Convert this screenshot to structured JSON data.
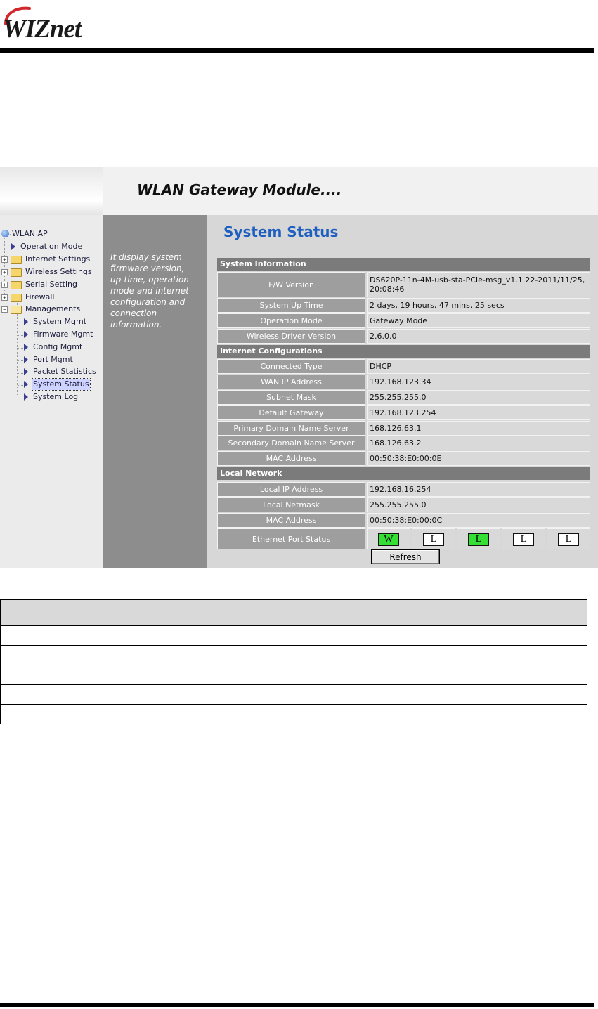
{
  "header": {
    "logo_text": "WIZnet"
  },
  "gateway": {
    "banner_title": "WLAN Gateway Module....",
    "tree": {
      "root": "WLAN AP",
      "items": [
        "Operation Mode",
        "Internet Settings",
        "Wireless Settings",
        "Serial Setting",
        "Firewall",
        "Managements",
        "System Mgmt",
        "Firmware Mgmt",
        "Config Mgmt",
        "Port Mgmt",
        "Packet Statistics",
        "System Status",
        "System Log"
      ],
      "selected": "System Status"
    },
    "description": "It display system firmware version, up-time, operation mode and internet configuration and connection information.",
    "page_title": "System Status",
    "sections": [
      {
        "title": "System Information",
        "rows": [
          {
            "label": "F/W Version",
            "value": "DS620P-11n-4M-usb-sta-PCIe-msg_v1.1.22-2011/11/25, 20:08:46"
          },
          {
            "label": "System Up Time",
            "value": "2 days, 19 hours, 47 mins, 25 secs"
          },
          {
            "label": "Operation Mode",
            "value": "Gateway Mode"
          },
          {
            "label": "Wireless Driver Version",
            "value": "2.6.0.0"
          }
        ]
      },
      {
        "title": "Internet Configurations",
        "rows": [
          {
            "label": "Connected Type",
            "value": "DHCP"
          },
          {
            "label": "WAN IP Address",
            "value": "192.168.123.34"
          },
          {
            "label": "Subnet Mask",
            "value": "255.255.255.0"
          },
          {
            "label": "Default Gateway",
            "value": "192.168.123.254"
          },
          {
            "label": "Primary Domain Name Server",
            "value": "168.126.63.1"
          },
          {
            "label": "Secondary Domain Name Server",
            "value": "168.126.63.2"
          },
          {
            "label": "MAC Address",
            "value": "00:50:38:E0:00:0E"
          }
        ]
      },
      {
        "title": "Local Network",
        "rows": [
          {
            "label": "Local IP Address",
            "value": "192.168.16.254"
          },
          {
            "label": "Local Netmask",
            "value": "255.255.255.0"
          },
          {
            "label": "MAC Address",
            "value": "00:50:38:E0:00:0C"
          }
        ]
      }
    ],
    "ethernet": {
      "label": "Ethernet Port Status",
      "ports": [
        {
          "letter": "W",
          "active": true
        },
        {
          "letter": "L",
          "active": false
        },
        {
          "letter": "L",
          "active": true
        },
        {
          "letter": "L",
          "active": false
        },
        {
          "letter": "L",
          "active": false
        }
      ]
    },
    "refresh_label": "Refresh",
    "colors": {
      "title_blue": "#1e5fbf",
      "port_active": "#33e033",
      "section_bar": "#7b7b7b"
    }
  }
}
